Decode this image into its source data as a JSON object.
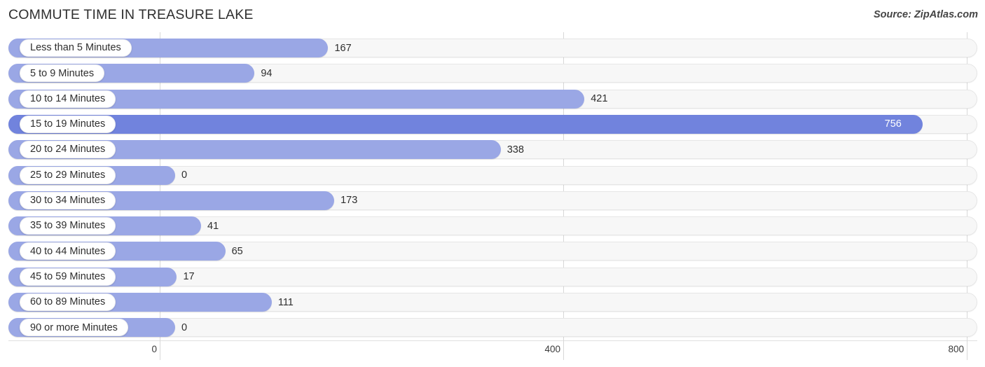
{
  "header": {
    "title": "COMMUTE TIME IN TREASURE LAKE",
    "source": "Source: ZipAtlas.com"
  },
  "chart_data": {
    "type": "bar",
    "orientation": "horizontal",
    "title": "COMMUTE TIME IN TREASURE LAKE",
    "xlabel": "",
    "ylabel": "",
    "xlim": [
      0,
      800
    ],
    "grid": true,
    "gridlines": [
      0,
      400,
      800
    ],
    "tick_labels": [
      "0",
      "400",
      "800"
    ],
    "legend": null,
    "colors": {
      "bar": "#9aa7e5",
      "bar_max": "#7183dd",
      "track": "#f7f7f7",
      "track_border": "#e6e6e6",
      "pill_background": "#ffffff",
      "text": "#2e2e2e",
      "value_text_inside": "#ffffff",
      "gridline": "#d8d8d8"
    },
    "categories": [
      "Less than 5 Minutes",
      "5 to 9 Minutes",
      "10 to 14 Minutes",
      "15 to 19 Minutes",
      "20 to 24 Minutes",
      "25 to 29 Minutes",
      "30 to 34 Minutes",
      "35 to 39 Minutes",
      "40 to 44 Minutes",
      "45 to 59 Minutes",
      "60 to 89 Minutes",
      "90 or more Minutes"
    ],
    "values": [
      167,
      94,
      421,
      756,
      338,
      0,
      173,
      41,
      65,
      17,
      111,
      0
    ],
    "value_labels": [
      "167",
      "94",
      "421",
      "756",
      "338",
      "0",
      "173",
      "41",
      "65",
      "17",
      "111",
      "0"
    ],
    "max_value": 756,
    "max_index": 3
  }
}
